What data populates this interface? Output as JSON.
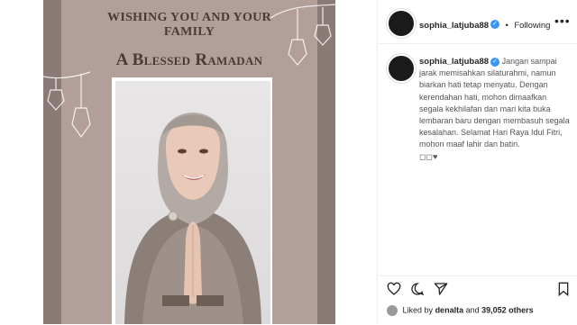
{
  "post": {
    "greeting_line1": "Wishing you and your",
    "greeting_line2": "family",
    "greeting_line3": "A Blessed Ramadan"
  },
  "header": {
    "username": "sophia_latjuba88",
    "separator": "•",
    "follow_status": "Following",
    "more_icon": "ellipsis-icon"
  },
  "caption": {
    "username": "sophia_latjuba88",
    "text": "Jangan sampai jarak memisahkan silaturahmi, namun biarkan hati tetap menyatu. Dengan kerendahan hati, mohon dimaafkan segala kekhilafan dan mari kita buka lembaran baru dengan membasuh segala kesalahan. Selamat Hari Raya Idul Fitri, mohon maaf lahir dan batin.",
    "emoji": "◻◻♥"
  },
  "actions": {
    "icons": [
      "heart-icon",
      "comment-icon",
      "share-icon",
      "bookmark-icon"
    ]
  },
  "likes": {
    "prefix": "Liked by",
    "user": "denalta",
    "connector": "and",
    "count": "39,052 others"
  },
  "colors": {
    "card": "#b29f9a",
    "strip": "#8a7b76",
    "verified": "#3897f0"
  }
}
